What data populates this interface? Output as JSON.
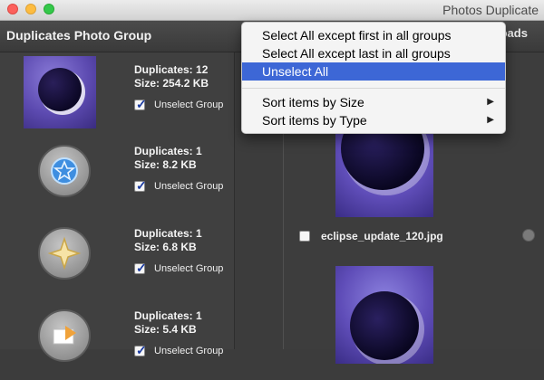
{
  "window": {
    "title": "Photos Duplicate"
  },
  "toolbar": {
    "group_header": "Duplicates Photo Group",
    "right_label": "loads"
  },
  "groups": [
    {
      "duplicates": "Duplicates: 12",
      "size": "Size: 254.2 KB",
      "checkbox_label": "Unselect Group",
      "checked": true,
      "icon": "eclipse-photo-icon"
    },
    {
      "duplicates": "Duplicates: 1",
      "size": "Size: 8.2 KB",
      "checkbox_label": "Unselect Group",
      "checked": true,
      "icon": "blue-star-badge-icon"
    },
    {
      "duplicates": "Duplicates: 1",
      "size": "Size: 6.8 KB",
      "checkbox_label": "Unselect Group",
      "checked": true,
      "icon": "gold-sparkle-badge-icon"
    },
    {
      "duplicates": "Duplicates: 1",
      "size": "Size: 5.4 KB",
      "checkbox_label": "Unselect Group",
      "checked": true,
      "icon": "export-arrow-badge-icon"
    }
  ],
  "preview": {
    "file_name": "eclipse_update_120.jpg"
  },
  "context_menu": {
    "items": [
      {
        "label": "Select All except first in all groups",
        "selected": false,
        "submenu": false
      },
      {
        "label": "Select All except last in all groups",
        "selected": false,
        "submenu": false
      },
      {
        "label": "Unselect All",
        "selected": true,
        "submenu": false
      },
      {
        "label": "Sort items by Size",
        "selected": false,
        "submenu": true
      },
      {
        "label": "Sort items by Type",
        "selected": false,
        "submenu": true
      }
    ]
  },
  "colors": {
    "menu_highlight": "#3d67d6",
    "panel_dark": "#3c3c3c",
    "checkbox_check": "#1a3aa0"
  }
}
